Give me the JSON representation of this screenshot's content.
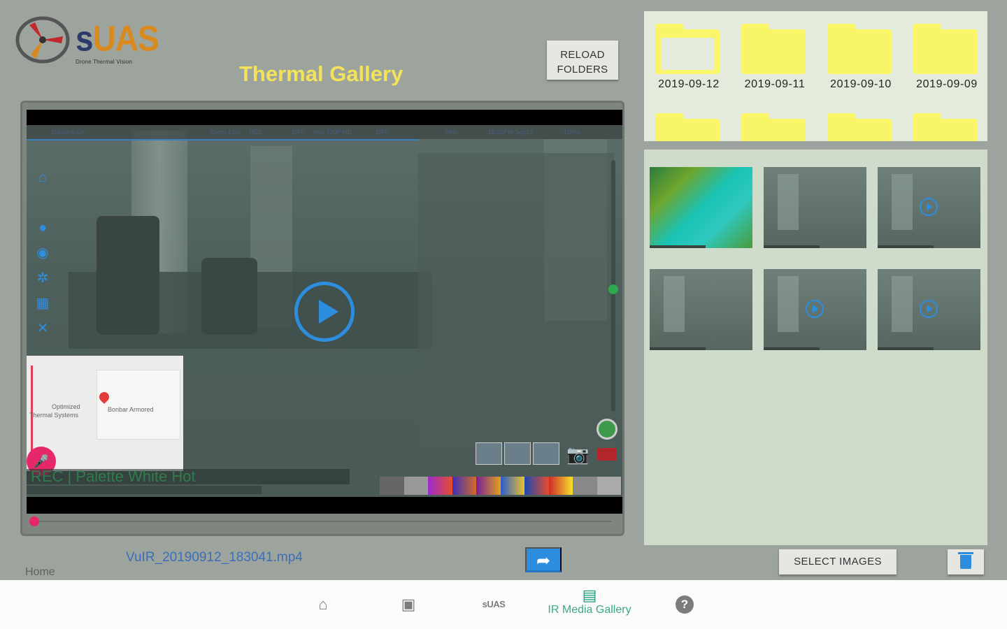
{
  "app": {
    "logo_text_s": "s",
    "logo_text_uas": "UAS",
    "logo_subtitle": "Drone Thermal Vision",
    "title": "Thermal Gallery"
  },
  "toolbar": {
    "reload_label_line1": "RELOAD",
    "reload_label_line2": "FOLDERS",
    "select_images_label": "SELECT IMAGES"
  },
  "player": {
    "file_name": "VuIR_20190912_183041.mp4",
    "status": {
      "datalink": "Datalink On",
      "zoom": "Zoom 1.0X",
      "rec": "REC",
      "off": "OFF",
      "res": "Res 720P HD",
      "off2": "OFF",
      "battery": "98%",
      "time": "18:30PM Sep12",
      "storage": "100%"
    },
    "palette_text": "REC   | Palette     White Hot",
    "map": {
      "label1": "Optimized",
      "label2": "Thermal Systems",
      "label3": "Bonbar Armored"
    }
  },
  "home_label": "Home",
  "folders": [
    {
      "name": "2019-09-12"
    },
    {
      "name": "2019-09-11"
    },
    {
      "name": "2019-09-10"
    },
    {
      "name": "2019-09-09"
    },
    {
      "name": ""
    },
    {
      "name": ""
    },
    {
      "name": ""
    },
    {
      "name": ""
    }
  ],
  "nav": {
    "active_label": "IR Media Gallery",
    "suas_label": "sUAS"
  },
  "colors": {
    "accent_blue": "#2d8ee0",
    "folder_yellow": "#f8f667",
    "title_yellow": "#f4e35a",
    "nav_active": "#1a9a7c"
  }
}
